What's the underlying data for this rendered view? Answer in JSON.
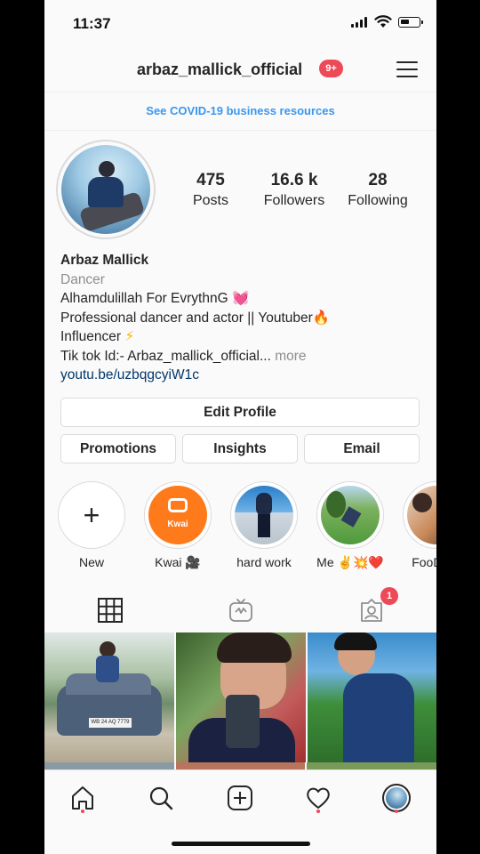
{
  "status_bar": {
    "time": "11:37"
  },
  "header": {
    "username": "arbaz_mallick_official",
    "notification_badge": "9+"
  },
  "banner": {
    "covid_link": "See COVID-19 business resources"
  },
  "stats": [
    {
      "value": "475",
      "label": "Posts"
    },
    {
      "value": "16.6 k",
      "label": "Followers"
    },
    {
      "value": "28",
      "label": "Following"
    }
  ],
  "bio": {
    "name": "Arbaz Mallick",
    "category": "Dancer",
    "line1": "Alhamdulillah For EvrythnG ",
    "line1_emoji": "💓",
    "line2": "Professional dancer and actor || Youtuber",
    "line2_emoji": "🔥",
    "line3": "Influencer ",
    "line3_emoji": "⚡",
    "line4": "Tik tok Id:- Arbaz_mallick_official... ",
    "more": "more",
    "link": "youtu.be/uzbqgcyiW1c"
  },
  "buttons": {
    "edit_profile": "Edit Profile",
    "promotions": "Promotions",
    "insights": "Insights",
    "email": "Email"
  },
  "highlights": [
    {
      "label": "New",
      "icon": "plus-icon"
    },
    {
      "label": "Kwai 🎥",
      "icon": "kwai-logo",
      "logo_text": "Kwai"
    },
    {
      "label": "hard work"
    },
    {
      "label": "Me ✌️💥❤️"
    },
    {
      "label": "FooD 🍔"
    }
  ],
  "tabs": {
    "grid": "grid-icon",
    "igtv": "igtv-icon",
    "tagged": "tagged-icon",
    "tagged_badge": "1"
  },
  "posts": [
    {
      "plate": "WB 24 AQ 7779"
    },
    {},
    {}
  ],
  "nav": [
    "home-icon",
    "search-icon",
    "add-post-icon",
    "activity-heart-icon",
    "profile-avatar"
  ],
  "colors": {
    "accent_blue": "#3897f0",
    "badge_red": "#ed4956",
    "link_navy": "#00376b"
  }
}
